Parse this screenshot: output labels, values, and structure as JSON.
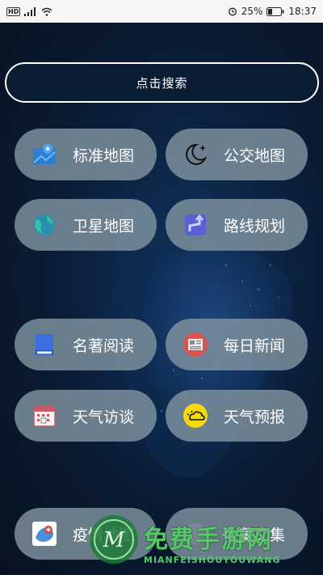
{
  "status": {
    "left_icons": [
      "hd-icon",
      "signal-icon",
      "wifi-icon"
    ],
    "hd_label": "HD",
    "battery": "25%",
    "time": "18:37"
  },
  "search": {
    "label": "点击搜索"
  },
  "buttons": {
    "standard_map": "标准地图",
    "transit_map": "公交地图",
    "satellite_map": "卫星地图",
    "route_planning": "路线规划",
    "classic_reading": "名著阅读",
    "daily_news": "每日新闻",
    "weather_talk": "天气访谈",
    "weather_forecast": "天气预报",
    "epidemic_map": "疫情地图",
    "extra": "收藏文集"
  },
  "watermark": {
    "title": "免费手游网",
    "subtitle": "MIANFEISHOUYOUWANG"
  },
  "colors": {
    "button_bg": "#8094a0",
    "background": "#0a1a30",
    "watermark": "#57c76a"
  }
}
